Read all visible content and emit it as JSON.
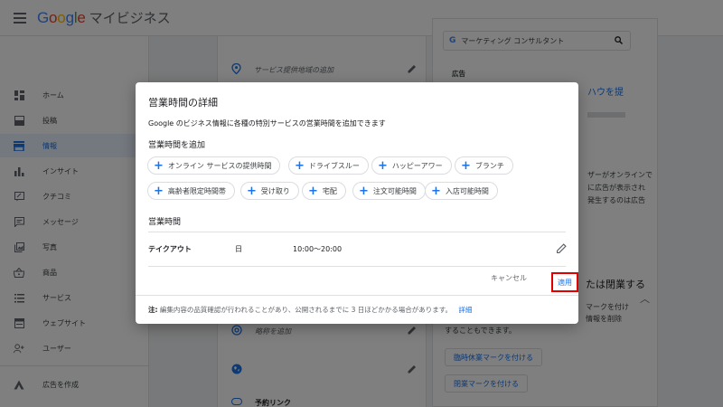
{
  "app": {
    "logo_text": "Google",
    "product": "マイビジネス"
  },
  "sidebar": {
    "items": [
      {
        "label": "ホーム",
        "icon": "dashboard-icon"
      },
      {
        "label": "投稿",
        "icon": "post-icon"
      },
      {
        "label": "情報",
        "icon": "store-icon",
        "active": true
      },
      {
        "label": "インサイト",
        "icon": "insights-icon"
      },
      {
        "label": "クチコミ",
        "icon": "review-icon"
      },
      {
        "label": "メッセージ",
        "icon": "message-icon"
      },
      {
        "label": "写真",
        "icon": "photo-icon"
      },
      {
        "label": "商品",
        "icon": "basket-icon"
      },
      {
        "label": "サービス",
        "icon": "list-icon"
      },
      {
        "label": "ウェブサイト",
        "icon": "website-icon"
      },
      {
        "label": "ユーザー",
        "icon": "add-user-icon"
      },
      {
        "label": "広告を作成",
        "icon": "ads-icon"
      }
    ]
  },
  "background": {
    "service_area": "サービス提供地域の追加",
    "short_name": "略称を追加",
    "booking_link": "予約リンク",
    "search_text": "マーケティング コンサルタント",
    "ad_label": "広告",
    "ad_link_fragment": "ハウを提",
    "right_text_1": "ザーがオンラインで",
    "right_text_2": "に広告が表示され",
    "right_text_3": "発生するのは広告",
    "closed_heading_fragment": "たは閉業する",
    "closed_text_1": "マークを付け",
    "closed_text_2": "情報を削除",
    "closed_text_3": "することもできます。",
    "temp_closed_button": "臨時休業マークを付ける",
    "closed_button": "閉業マークを付ける"
  },
  "dialog": {
    "title": "営業時間の詳細",
    "description": "Google のビジネス情報に各種の特別サービスの営業時間を追加できます",
    "add_heading": "営業時間を追加",
    "chips": [
      "オンライン サービスの提供時間",
      "ドライブスルー",
      "ハッピーアワー",
      "ブランチ",
      "高齢者限定時間帯",
      "受け取り",
      "宅配",
      "注文可能時間",
      "入店可能時間"
    ],
    "hours_heading": "営業時間",
    "hours_row": {
      "name": "テイクアウト",
      "day": "日",
      "time": "10:00～20:00"
    },
    "cancel_label": "キャンセル",
    "apply_label": "適用",
    "note_prefix": "注:",
    "note_text": "編集内容の品質確認が行われることがあり、公開されるまでに 3 日ほどかかる場合があります。",
    "note_link": "詳細"
  },
  "colors": {
    "accent": "#1a73e8",
    "highlight": "#e00000"
  }
}
